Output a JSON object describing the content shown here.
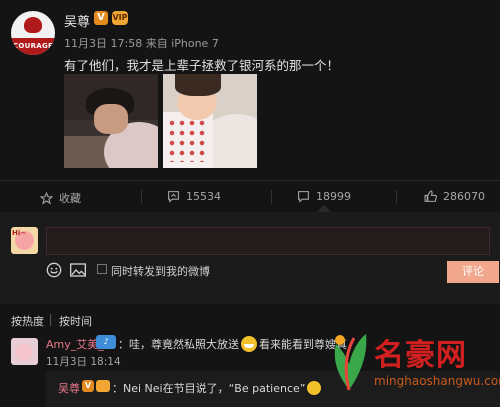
{
  "post": {
    "username": "吴尊",
    "verified_badge": "V",
    "date": "11月3日 17:58",
    "source": "来自 iPhone 7",
    "text": "有了他们，我才是上辈子拯救了银河系的那一个！"
  },
  "actions": {
    "favorite_label": "收藏",
    "repost_count": "15534",
    "comment_count": "18999",
    "like_count": "286070"
  },
  "comment_box": {
    "forward_label": "同时转发到我的微博",
    "submit_label": "评论"
  },
  "sort": {
    "hot_label": "按热度",
    "time_label": "按时间"
  },
  "comments": [
    {
      "user": "Amy_艾美_",
      "text_before": "：哇，尊竟然私照大放送",
      "text_after": "看来能看到尊嫂真",
      "time": "11月3日 18:14"
    }
  ],
  "reply": {
    "user": "吴尊",
    "verified_badge": "V",
    "text": "：Nei Nei在节目说了，“Be patience”"
  },
  "watermark": {
    "title": "名豪网",
    "url": "minghaoshangwu.com"
  },
  "colors": {
    "background": "#141414",
    "accent_pink": "#e8788a",
    "submit_bg": "#f0a78b",
    "verified": "#e48a1e"
  },
  "icons": [
    "star-icon",
    "repost-icon",
    "comment-icon",
    "thumbs-up-icon",
    "emoji-icon",
    "image-icon"
  ]
}
